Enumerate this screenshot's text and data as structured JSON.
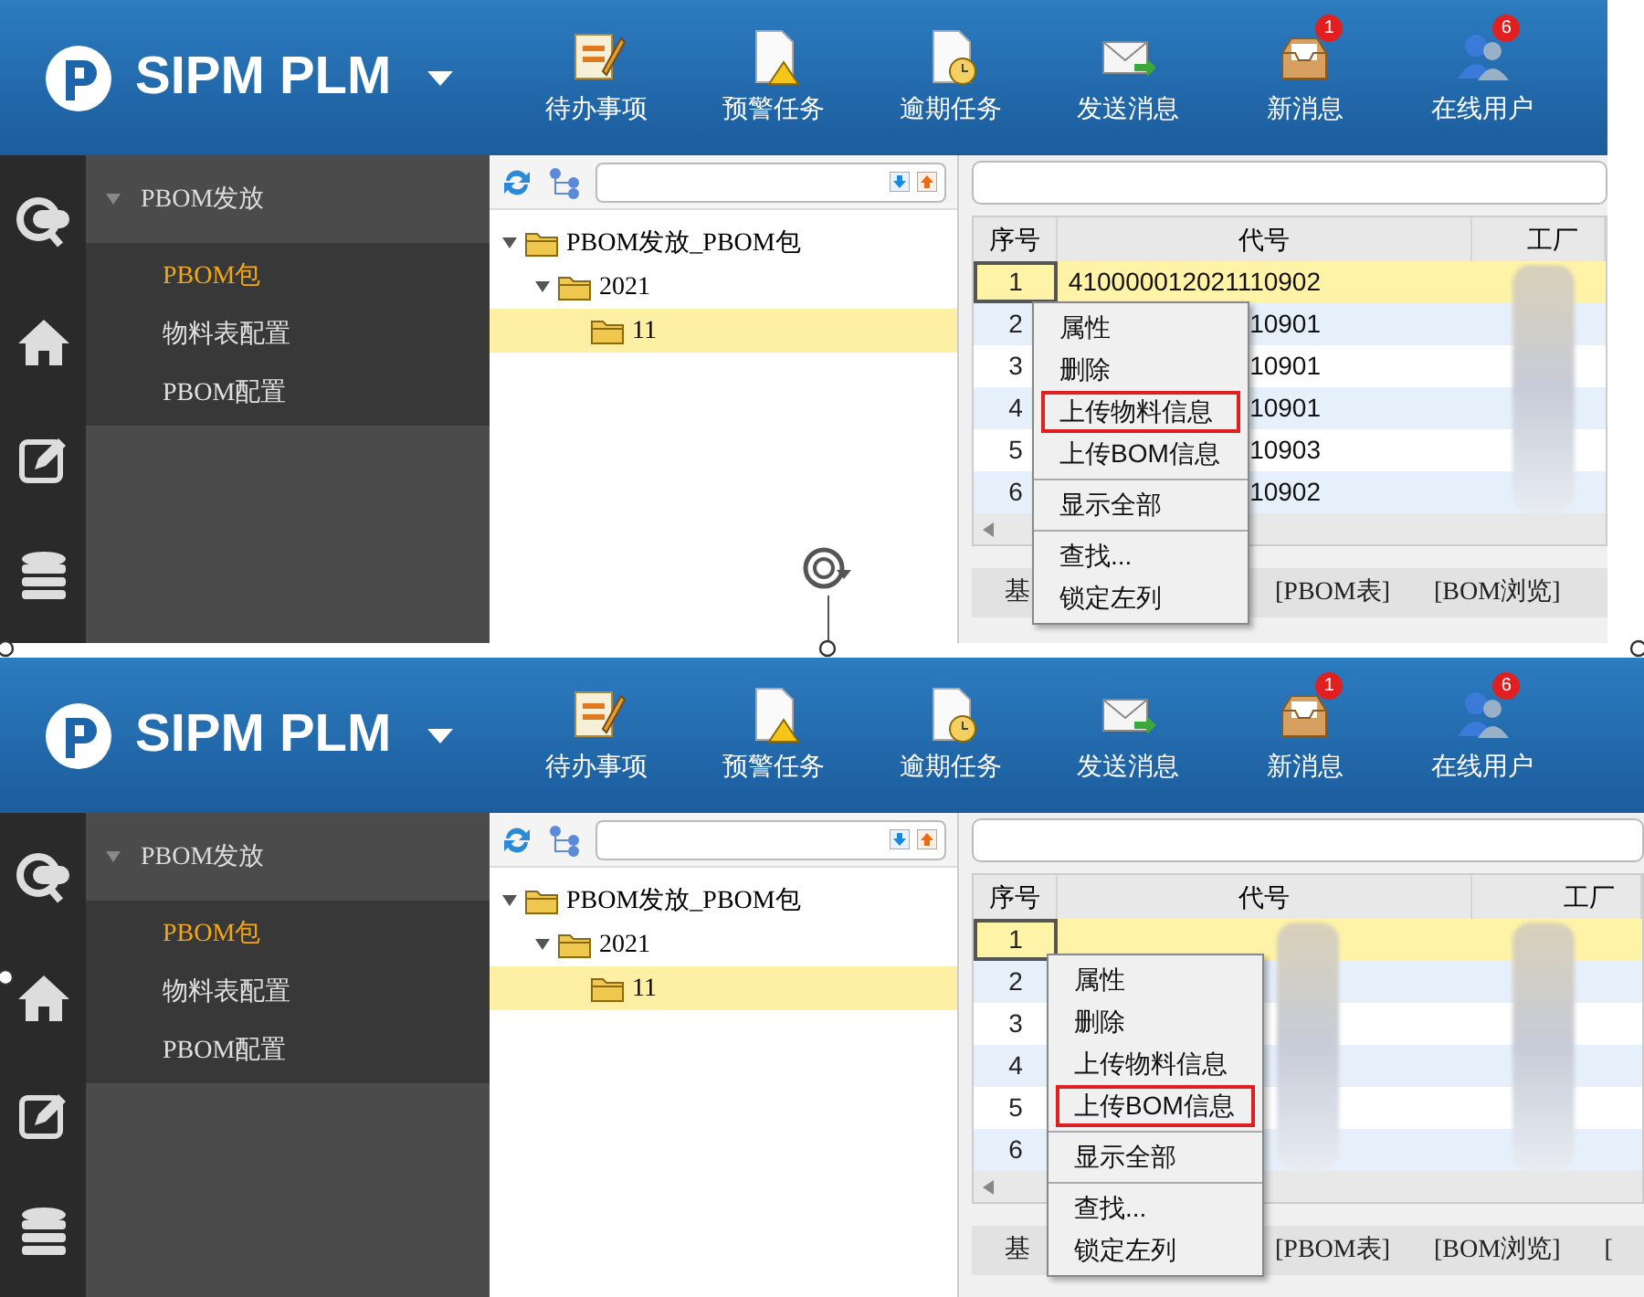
{
  "panels": [
    {
      "app_title": "SIPM PLM",
      "toolbar": [
        {
          "label": "待办事项",
          "kind": "todo"
        },
        {
          "label": "预警任务",
          "kind": "warning"
        },
        {
          "label": "逾期任务",
          "kind": "overdue"
        },
        {
          "label": "发送消息",
          "kind": "send"
        },
        {
          "label": "新消息",
          "kind": "inbox",
          "badge": "1"
        },
        {
          "label": "在线用户",
          "kind": "users",
          "badge": "6"
        }
      ],
      "nav": {
        "group": "PBOM发放",
        "expanded": true,
        "items": [
          {
            "label": "PBOM包",
            "selected": true
          },
          {
            "label": "物料表配置",
            "selected": false
          },
          {
            "label": "PBOM配置",
            "selected": false
          }
        ]
      },
      "tree": [
        {
          "label": "PBOM发放_PBOM包",
          "expanded": true,
          "selected": false,
          "children": [
            {
              "label": "2021",
              "expanded": true,
              "selected": false,
              "children": [
                {
                  "label": "11",
                  "selected": true
                }
              ]
            }
          ]
        }
      ],
      "table": {
        "columns": [
          {
            "label": "序号"
          },
          {
            "label": "代号"
          },
          {
            "label": "工厂",
            "redacted": true
          }
        ],
        "rows": [
          {
            "index": "1",
            "code": "410000012021110902",
            "selected": true
          },
          {
            "index": "2",
            "code": "10901",
            "selected": false
          },
          {
            "index": "3",
            "code": "10901",
            "selected": false
          },
          {
            "index": "4",
            "code": "10901",
            "selected": false
          },
          {
            "index": "5",
            "code": "10903",
            "selected": false
          },
          {
            "index": "6",
            "code": "10902",
            "selected": false
          }
        ]
      },
      "context_menu": {
        "groups": [
          [
            {
              "label": "属性",
              "highlighted": false
            },
            {
              "label": "删除",
              "highlighted": false
            },
            {
              "label": "上传物料信息",
              "highlighted": true
            },
            {
              "label": "上传BOM信息",
              "highlighted": false
            }
          ],
          [
            {
              "label": "显示全部",
              "highlighted": false
            }
          ],
          [
            {
              "label": "查找...",
              "highlighted": false
            },
            {
              "label": "锁定左列",
              "highlighted": false
            }
          ]
        ]
      },
      "tabs": [
        "基",
        "[PBOM表]",
        "[BOM浏览]"
      ]
    },
    {
      "app_title": "SIPM PLM",
      "toolbar": [
        {
          "label": "待办事项",
          "kind": "todo"
        },
        {
          "label": "预警任务",
          "kind": "warning"
        },
        {
          "label": "逾期任务",
          "kind": "overdue"
        },
        {
          "label": "发送消息",
          "kind": "send"
        },
        {
          "label": "新消息",
          "kind": "inbox",
          "badge": "1"
        },
        {
          "label": "在线用户",
          "kind": "users",
          "badge": "6"
        }
      ],
      "nav": {
        "group": "PBOM发放",
        "expanded": true,
        "items": [
          {
            "label": "PBOM包",
            "selected": true
          },
          {
            "label": "物料表配置",
            "selected": false
          },
          {
            "label": "PBOM配置",
            "selected": false
          }
        ]
      },
      "tree": [
        {
          "label": "PBOM发放_PBOM包",
          "expanded": true,
          "selected": false,
          "children": [
            {
              "label": "2021",
              "expanded": true,
              "selected": false,
              "children": [
                {
                  "label": "11",
                  "selected": true
                }
              ]
            }
          ]
        }
      ],
      "table": {
        "columns": [
          {
            "label": "序号"
          },
          {
            "label": "代号",
            "redacted": true
          },
          {
            "label": "工厂",
            "redacted": true
          }
        ],
        "rows": [
          {
            "index": "1",
            "selected": true
          },
          {
            "index": "2",
            "selected": false
          },
          {
            "index": "3",
            "selected": false
          },
          {
            "index": "4",
            "selected": false
          },
          {
            "index": "5",
            "selected": false
          },
          {
            "index": "6",
            "selected": false
          }
        ]
      },
      "context_menu": {
        "groups": [
          [
            {
              "label": "属性",
              "highlighted": false
            },
            {
              "label": "删除",
              "highlighted": false
            },
            {
              "label": "上传物料信息",
              "highlighted": false
            },
            {
              "label": "上传BOM信息",
              "highlighted": true
            }
          ],
          [
            {
              "label": "显示全部",
              "highlighted": false
            }
          ],
          [
            {
              "label": "查找...",
              "highlighted": false
            },
            {
              "label": "锁定左列",
              "highlighted": false
            }
          ]
        ]
      },
      "tabs": [
        "基",
        "[PBOM表]",
        "[BOM浏览]",
        "["
      ]
    }
  ]
}
